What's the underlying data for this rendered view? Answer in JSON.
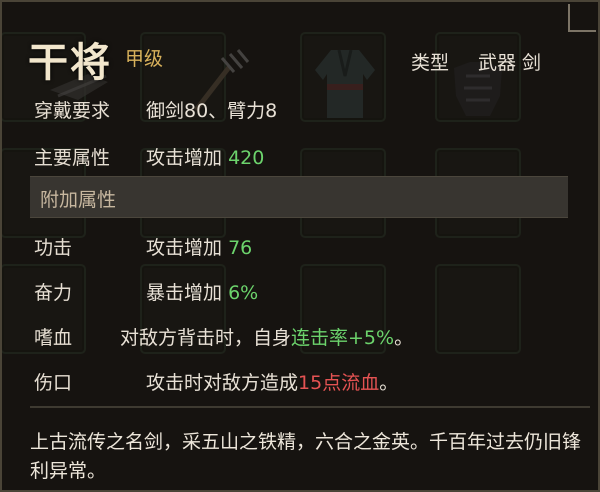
{
  "item": {
    "name": "干将",
    "grade": "甲级",
    "type_label": "类型",
    "type_value": "武器 剑"
  },
  "requirements": {
    "label": "穿戴要求",
    "value": "御剑80、臂力8"
  },
  "main_attr": {
    "label": "主要属性",
    "text": "攻击增加",
    "amount": "420"
  },
  "extra_section": {
    "title": "附加属性"
  },
  "extra_attrs": [
    {
      "label": "功击",
      "text": "攻击增加",
      "amount": "76"
    },
    {
      "label": "奋力",
      "text": "暴击增加",
      "amount": "6%"
    },
    {
      "label": "嗜血",
      "prefix": "对敌方背击时，自身",
      "highlight": "连击率+5%",
      "suffix": "。"
    },
    {
      "label": "伤口",
      "prefix": "攻击时对敌方造成",
      "highlight": "15点流血",
      "suffix": "。"
    }
  ],
  "description": "上古流传之名剑，采五山之铁精，六合之金英。千百年过去仍旧锋利异常。",
  "colors": {
    "title": "#f2e6cc",
    "grade": "#d8b15b",
    "positive": "#6cd36c",
    "negative": "#e55353"
  },
  "icons": [
    "sword-item-icon",
    "pitchfork-item-icon",
    "robe-item-icon",
    "armor-item-icon"
  ]
}
